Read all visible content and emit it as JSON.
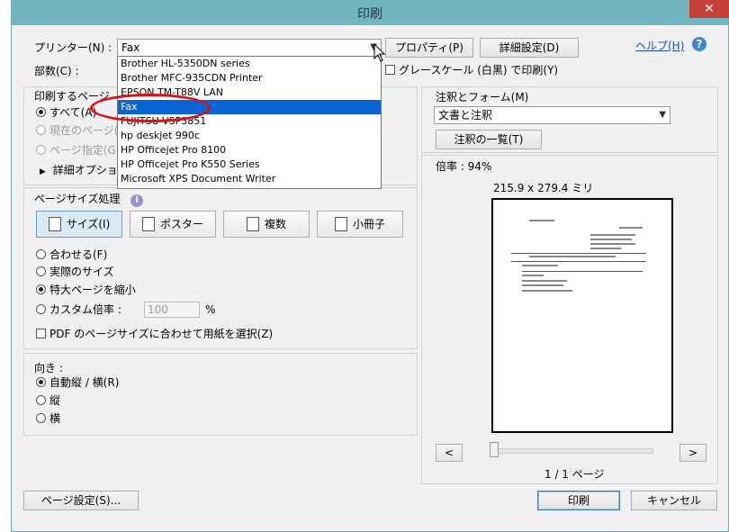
{
  "window": {
    "title": "印刷",
    "close_glyph": "✕"
  },
  "printer": {
    "label": "プリンター(N) :",
    "value": "Fax",
    "properties_button": "プロパティ(P)",
    "advanced_button": "詳細設定(D)",
    "help_link": "ヘルプ(H)",
    "help_icon": "?",
    "dropdown_items": [
      "Brother HL-5350DN series",
      "Brother MFC-935CDN Printer",
      "EPSON TM-T88V LAN",
      "Fax",
      "FUJITSU VSP3851",
      "hp deskjet 990c",
      "HP Officejet Pro 8100",
      "HP Officejet Pro K550 Series",
      "Microsoft XPS Document Writer"
    ],
    "selected_index": 3
  },
  "copies": {
    "label": "部数(C) :"
  },
  "grayscale": {
    "label": "グレースケール (白黒) で印刷(Y)",
    "checked": false
  },
  "pages_to_print": {
    "label": "印刷するページ",
    "options": [
      "すべて(A)",
      "現在のページ(U)",
      "ページ指定(G)"
    ],
    "selected_index": 0,
    "more_options": "詳細オプション"
  },
  "page_sizing": {
    "label": "ページサイズ処理",
    "info_icon": "i",
    "buttons": [
      "サイズ(I)",
      "ポスター",
      "複数",
      "小冊子"
    ],
    "selected_button": 0,
    "options": [
      "合わせる(F)",
      "実際のサイズ",
      "特大ページを縮小",
      "カスタム倍率 :"
    ],
    "selected_option": 2,
    "custom_scale_value": "100",
    "percent": "%",
    "choose_paper_label": "PDF のページサイズに合わせて用紙を選択(Z)"
  },
  "orientation": {
    "label": "向き :",
    "options": [
      "自動縦 / 横(R)",
      "縦",
      "横"
    ],
    "selected_index": 0
  },
  "comments_forms": {
    "label": "注釈とフォーム(M)",
    "value": "文書と注釈",
    "summarize_button": "注釈の一覧(T)"
  },
  "preview": {
    "scale_text": "倍率 : 94%",
    "paper_size": "215.9 x 279.4 ミリ",
    "prev_button": "<",
    "next_button": ">",
    "page_indicator": "1 / 1 ページ"
  },
  "footer": {
    "page_setup_button": "ページ設定(S)...",
    "print_button": "印刷",
    "cancel_button": "キャンセル"
  },
  "colors": {
    "title_bar": "#71b5bf",
    "close": "#c7413a",
    "selection": "#0a64d2",
    "annotation": "#e01010"
  }
}
